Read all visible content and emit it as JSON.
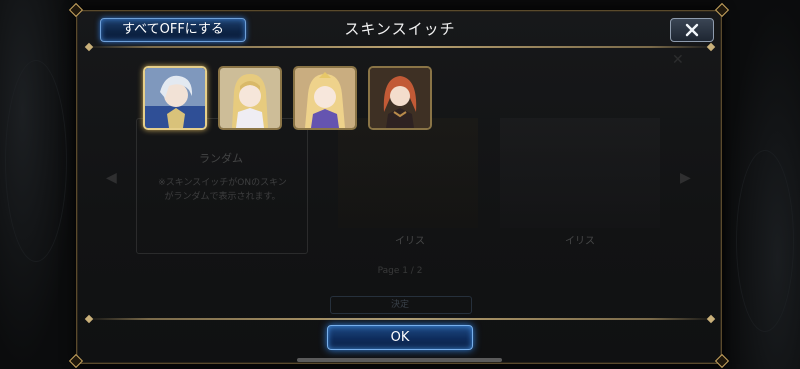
{
  "header": {
    "title": "スキンスイッチ",
    "all_off_label": "すべてOFFにする",
    "close_icon": "close-icon"
  },
  "portraits": [
    {
      "name": "silver-hair-knight",
      "selected": true,
      "hair": "#dfe6ee",
      "outfit": "#3c5fa8",
      "bg": "#8fa6c6"
    },
    {
      "name": "blonde-girl-1",
      "selected": false,
      "hair": "#e9cf86",
      "outfit": "#f3f0f6",
      "bg": "#d8c8a2"
    },
    {
      "name": "blonde-girl-2",
      "selected": false,
      "hair": "#efd48d",
      "outfit": "#6a58b8",
      "bg": "#cfb58a"
    },
    {
      "name": "red-hair-girl",
      "selected": false,
      "hair": "#c8603c",
      "outfit": "#3a2a2a",
      "bg": "#4a3a2a"
    }
  ],
  "background": {
    "panel_title": "ランダム",
    "panel_desc_line1": "※スキンスイッチがONのスキン",
    "panel_desc_line2": "がランダムで表示されます。",
    "card1_name": "イリス",
    "card2_name": "イリス",
    "page_label": "Page 1 / 2",
    "confirm_label": "決定"
  },
  "footer": {
    "ok_label": "OK"
  },
  "colors": {
    "accent_blue": "#2d6fc7",
    "gold": "#c9a660"
  }
}
